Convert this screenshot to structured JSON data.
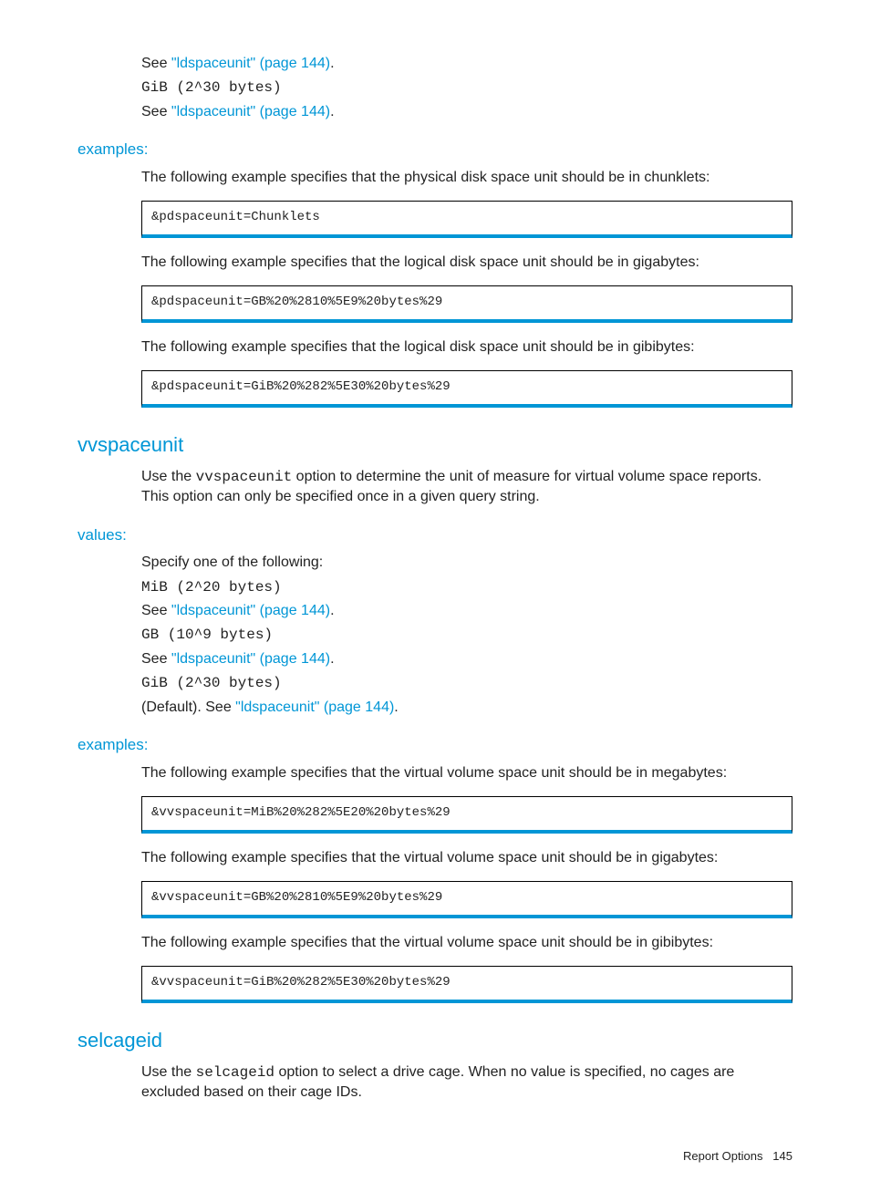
{
  "top": {
    "see1_pre": "See ",
    "see1_link": "\"ldspaceunit\" (page 144)",
    "see1_post": ".",
    "code1": "GiB (2^30 bytes)",
    "see2_pre": "See ",
    "see2_link": "\"ldspaceunit\" (page 144)",
    "see2_post": "."
  },
  "examples1": {
    "heading": "examples:",
    "p1": "The following example specifies that the physical disk space unit should be in chunklets:",
    "c1": "&pdspaceunit=Chunklets",
    "p2": "The following example specifies that the logical disk space unit should be in gigabytes:",
    "c2": "&pdspaceunit=GB%20%2810%5E9%20bytes%29",
    "p3": "The following example specifies that the logical disk space unit should be in gibibytes:",
    "c3": "&pdspaceunit=GiB%20%282%5E30%20bytes%29"
  },
  "vvspaceunit": {
    "heading": "vvspaceunit",
    "intro_pre": "Use the ",
    "intro_mono": "vvspaceunit",
    "intro_post": " option to determine the unit of measure for virtual volume space reports. This option can only be specified once in a given query string."
  },
  "values": {
    "heading": "values:",
    "lead": "Specify one of the following:",
    "v1_code": "MiB (2^20 bytes)",
    "v1_see_pre": "See ",
    "v1_see_link": "\"ldspaceunit\" (page 144)",
    "v1_see_post": ".",
    "v2_code": "GB (10^9 bytes)",
    "v2_see_pre": "See ",
    "v2_see_link": "\"ldspaceunit\" (page 144)",
    "v2_see_post": ".",
    "v3_code": "GiB (2^30 bytes)",
    "v3_see_pre": "(Default). See ",
    "v3_see_link": "\"ldspaceunit\" (page 144)",
    "v3_see_post": "."
  },
  "examples2": {
    "heading": "examples:",
    "p1": "The following example specifies that the virtual volume space unit should be in megabytes:",
    "c1": "&vvspaceunit=MiB%20%282%5E20%20bytes%29",
    "p2": "The following example specifies that the virtual volume space unit should be in gigabytes:",
    "c2": "&vvspaceunit=GB%20%2810%5E9%20bytes%29",
    "p3": "The following example specifies that the virtual volume space unit should be in gibibytes:",
    "c3": "&vvspaceunit=GiB%20%282%5E30%20bytes%29"
  },
  "selcageid": {
    "heading": "selcageid",
    "intro_pre": "Use the ",
    "intro_mono": "selcageid",
    "intro_post": " option to select a drive cage. When no value is specified, no cages are excluded based on their cage IDs."
  },
  "footer": {
    "label": "Report Options",
    "page": "145"
  }
}
